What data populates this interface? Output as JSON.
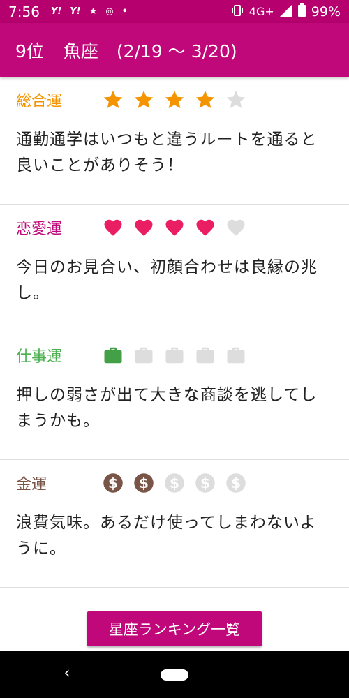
{
  "status_bar": {
    "time": "7:56",
    "icons_left": [
      "Y!",
      "Y!",
      "★",
      "◎",
      "•"
    ],
    "network": "4G+",
    "battery": "99%"
  },
  "header": {
    "rank": "9位",
    "sign": "魚座",
    "dates": "(2/19 〜 3/20)",
    "background_color": "#c0087a"
  },
  "sections": [
    {
      "key": "overall",
      "title": "総合運",
      "title_color": "#f39400",
      "icon": "star-icon",
      "active_color": "#f39400",
      "rating": 4,
      "max": 5,
      "text": "通勤通学はいつもと違うルートを通ると良いことがありそう！"
    },
    {
      "key": "love",
      "title": "恋愛運",
      "title_color": "#c0087a",
      "icon": "heart-icon",
      "active_color": "#e91e63",
      "rating": 4,
      "max": 5,
      "text": "今日のお見合い、初顔合わせは良縁の兆し。"
    },
    {
      "key": "work",
      "title": "仕事運",
      "title_color": "#4caf50",
      "icon": "briefcase-icon",
      "active_color": "#43a047",
      "rating": 1,
      "max": 5,
      "text": "押しの弱さが出て大きな商談を逃してしまうかも。"
    },
    {
      "key": "money",
      "title": "金運",
      "title_color": "#795548",
      "icon": "dollar-coin-icon",
      "active_color": "#795548",
      "rating": 2,
      "max": 5,
      "text": "浪費気味。あるだけ使ってしまわないように。"
    }
  ],
  "inactive_color": "#dddddd",
  "ranking_button": {
    "label": "星座ランキング一覧"
  },
  "nav_bar": {
    "back_icon": "back-icon",
    "home_icon": "home-pill-icon"
  }
}
